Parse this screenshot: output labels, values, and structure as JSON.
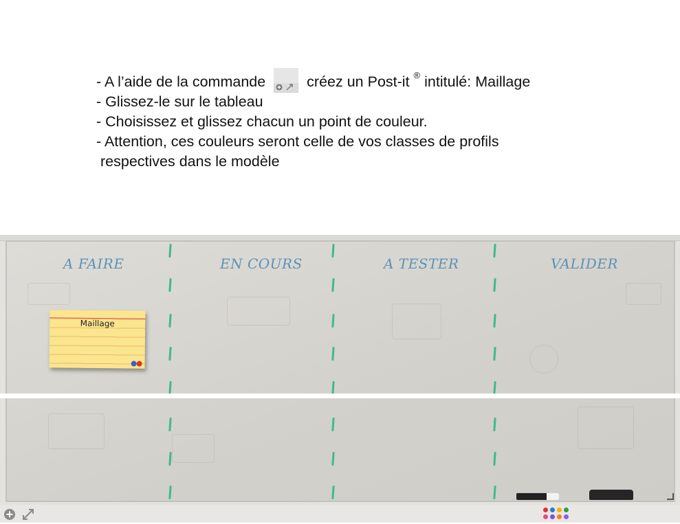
{
  "instructions": {
    "line1_before": "- A l’aide de la commande",
    "line1_after": "créez un Post-it",
    "line1_reg": "®",
    "line1_end": "intitulé: Maillage",
    "line2": "- Glissez-le sur le tableau",
    "line3": "- Choisissez et glissez chacun un point de couleur.",
    "line4": "- Attention, ces couleurs seront celle de vos classes de profils",
    "line5": "respectives dans le modèle"
  },
  "board": {
    "columns": [
      {
        "label": "A FAIRE"
      },
      {
        "label": "EN COURS"
      },
      {
        "label": "A TESTER"
      },
      {
        "label": "VALIDER"
      }
    ],
    "accent_color": "#5b92b8",
    "divider_color": "#3dbb8a"
  },
  "postit": {
    "title": "Maillage",
    "color": "#fbe58f",
    "dot_colors": [
      "#3a5fcd",
      "#d9342b"
    ]
  },
  "toolbar": {
    "add_icon": "plus-circle-icon",
    "expand_icon": "expand-arrows-icon",
    "palette_colors": [
      "#e03131",
      "#1c7ed6",
      "#fab005",
      "#2f9e44",
      "#e64980",
      "#7950f2",
      "#fd7e14",
      "#845ef7"
    ]
  }
}
